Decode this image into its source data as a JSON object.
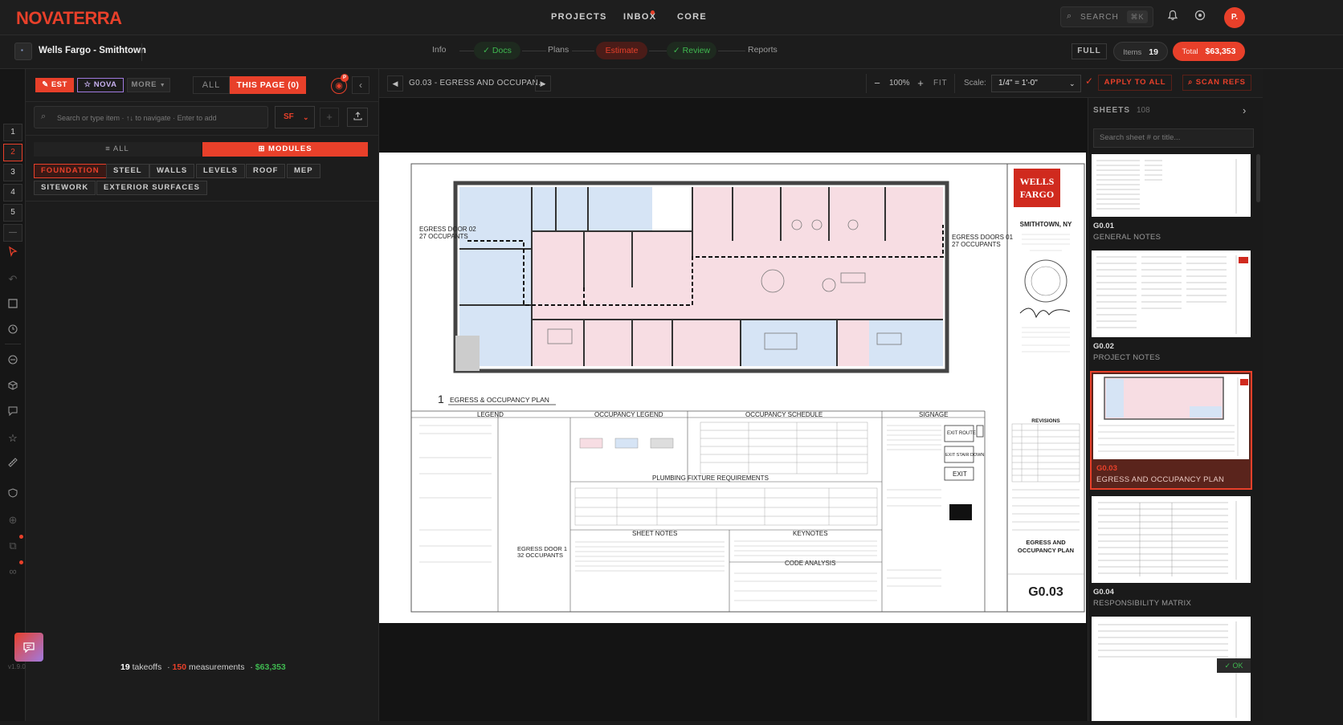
{
  "app": {
    "logo": "NOVATERRA",
    "nav": [
      "PROJECTS",
      "INBOX",
      "CORE"
    ],
    "search_label": "SEARCH",
    "search_shortcut": "⌘K",
    "avatar_initial": "P."
  },
  "project": {
    "name": "Wells Fargo - Smithtown",
    "tabs": [
      "Info",
      "Docs",
      "Plans",
      "Estimate",
      "Review",
      "Reports"
    ],
    "full_label": "FULL",
    "items_label": "Items",
    "items_count": "19",
    "total_label": "Total",
    "total_value": "$63,353"
  },
  "left_rail": {
    "numbers": [
      "1",
      "2",
      "3",
      "4",
      "5",
      "—"
    ],
    "version": "v1.9.0"
  },
  "left_panel": {
    "est_label": "EST",
    "nova_label": "NOVA",
    "more_label": "MORE",
    "filter_all": "ALL",
    "filter_this_page": "THIS PAGE (0)",
    "badge": "P",
    "search_placeholder": "Search or type item · ↑↓ to navigate · Enter to add",
    "unit": "SF",
    "view_all": "≡ ALL",
    "view_modules": "⊞ MODULES",
    "modules": [
      "FOUNDATION",
      "STEEL",
      "WALLS",
      "LEVELS",
      "ROOF",
      "MEP",
      "SITEWORK",
      "EXTERIOR SURFACES"
    ],
    "footer_takeoffs_count": "19",
    "footer_takeoffs_label": "takeoffs",
    "footer_measurements_count": "150",
    "footer_measurements_label": "measurements",
    "footer_total": "$63,353"
  },
  "viewer": {
    "sheet_title": "G0.03 - EGRESS AND OCCUPAN...",
    "zoom": "100%",
    "fit": "FIT",
    "scale_label": "Scale:",
    "scale_value": "1/4\" = 1'-0\"",
    "apply_all": "APPLY TO ALL",
    "scan_refs": "SCAN REFS"
  },
  "sheet_drawing": {
    "plan_title": "EGRESS & OCCUPANCY PLAN",
    "plan_number": "1",
    "egress_left": "EGRESS DOOR 02",
    "egress_left_occ": "27 OCCUPANTS",
    "egress_right": "EGRESS DOORS 01",
    "egress_right_occ": "27 OCCUPANTS",
    "egress_bottom": "EGRESS DOOR 1",
    "egress_bottom_occ": "32 OCCUPANTS",
    "legend": "LEGEND",
    "occupancy_legend": "OCCUPANCY LEGEND",
    "occupancy_schedule": "OCCUPANCY SCHEDULE",
    "signage": "SIGNAGE",
    "plumbing": "PLUMBING FIXTURE REQUIREMENTS",
    "sheet_notes": "SHEET NOTES",
    "keynotes": "KEYNOTES",
    "code_analysis": "CODE ANALYSIS",
    "revisions": "REVISIONS",
    "brand_line1": "WELLS",
    "brand_line2": "FARGO",
    "location": "SMITHTOWN, NY",
    "sheet_name_line1": "EGRESS AND",
    "sheet_name_line2": "OCCUPANCY PLAN",
    "sheet_number": "G0.03",
    "exit_route": "EXIT ROUTE",
    "exit_stair": "EXIT STAIR DOWN",
    "exit": "EXIT"
  },
  "sheets": {
    "title": "SHEETS",
    "count": "108",
    "search_placeholder": "Search sheet # or title...",
    "items": [
      {
        "number": "G0.01",
        "name": "GENERAL NOTES"
      },
      {
        "number": "G0.02",
        "name": "PROJECT NOTES"
      },
      {
        "number": "G0.03",
        "name": "EGRESS AND OCCUPANCY PLAN"
      },
      {
        "number": "G0.04",
        "name": "RESPONSIBILITY MATRIX"
      }
    ],
    "ok_label": "OK"
  },
  "colors": {
    "accent": "#e8402a",
    "green": "#3fb950",
    "nova": "#a07ae0",
    "plan_pink": "#f7dde3",
    "plan_blue": "#d6e4f5"
  }
}
